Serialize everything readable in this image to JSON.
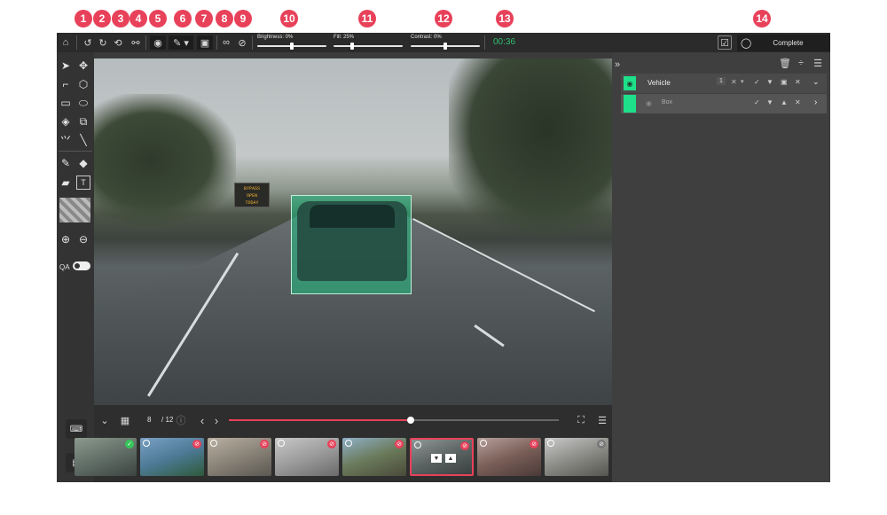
{
  "badges": [
    "1",
    "2",
    "3",
    "4",
    "5",
    "6",
    "7",
    "8",
    "9",
    "10",
    "11",
    "12",
    "13",
    "14"
  ],
  "toolbar": {
    "brightness": {
      "label": "Brightness: 0%",
      "level": 0.5
    },
    "fill": {
      "label": "Fill: 25%",
      "level": 0.25
    },
    "contrast": {
      "label": "Contrast: 0%",
      "level": 0.5
    },
    "timer": "00:36",
    "complete_label": "Complete"
  },
  "left_tools": {
    "qa_label": "QA"
  },
  "canvas": {
    "sign_lines": [
      "BYPASS",
      "OPEN",
      "TODAY"
    ]
  },
  "right_panel": {
    "class_label": "Vehicle",
    "count": "1",
    "object_label": "Box",
    "colors": {
      "accent": "#1ee08a"
    }
  },
  "film": {
    "current_frame": "8",
    "total_frames": "/ 12",
    "progress": 0.55
  },
  "thumbs": [
    {
      "status": "ok"
    },
    {
      "status": "reject"
    },
    {
      "status": "reject"
    },
    {
      "status": "reject"
    },
    {
      "status": "reject"
    },
    {
      "status": "reject",
      "selected": true
    },
    {
      "status": "reject"
    },
    {
      "status": "none"
    }
  ]
}
